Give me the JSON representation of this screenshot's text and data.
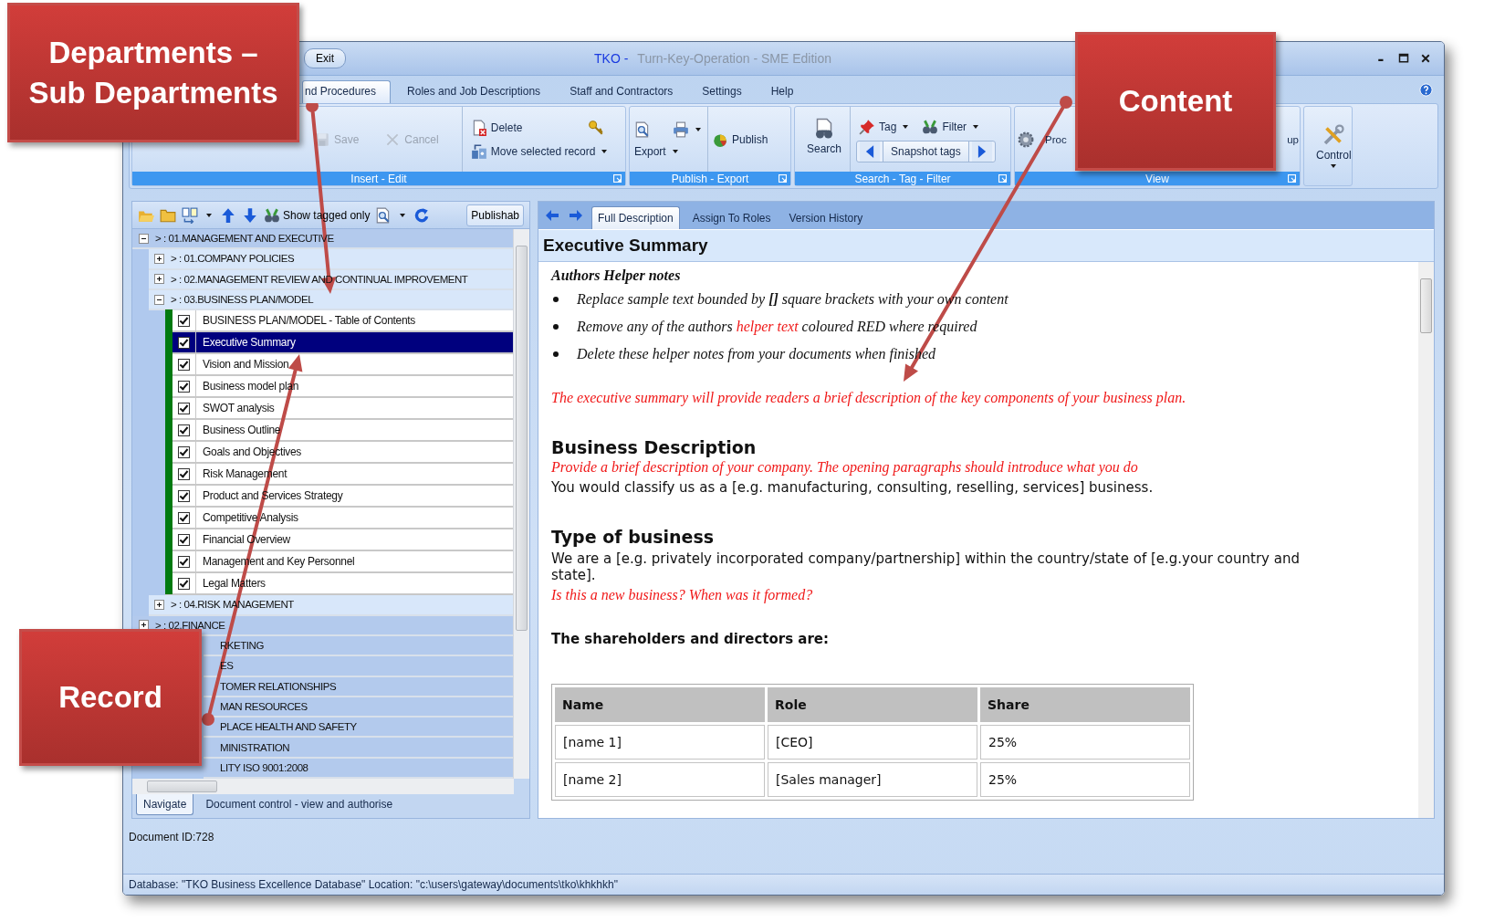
{
  "callouts": [
    {
      "kind": "departments",
      "lines": [
        "Departments –",
        "Sub Departments"
      ]
    },
    {
      "kind": "content",
      "lines": [
        "Content"
      ]
    },
    {
      "kind": "record",
      "lines": [
        "Record"
      ]
    }
  ],
  "window": {
    "exit_button": "Exit",
    "title_app": "TKO -",
    "title": "Turn-Key-Operation - SME Edition"
  },
  "menu_tabs": [
    {
      "label": "nd Procedures",
      "selected": true
    },
    {
      "label": "Roles and Job Descriptions",
      "selected": false
    },
    {
      "label": "Staff and Contractors",
      "selected": false
    },
    {
      "label": "Settings",
      "selected": false
    },
    {
      "label": "Help",
      "selected": false
    }
  ],
  "ribbon": [
    {
      "caption": "Insert - Edit",
      "columns": [
        [
          [
            {
              "kind": "small",
              "label": "Save",
              "disabled": true,
              "dropdown": false
            },
            {
              "kind": "small",
              "label": "Cancel",
              "disabled": true,
              "dropdown": false
            }
          ]
        ],
        [
          [
            {
              "kind": "small",
              "label": "Delete",
              "disabled": false,
              "dropdown": false
            },
            {
              "kind": "icon",
              "disabled": false,
              "dropdown": false
            }
          ],
          [
            {
              "kind": "small",
              "label": "Move selected record",
              "disabled": false,
              "dropdown": true
            }
          ]
        ]
      ]
    },
    {
      "caption": "Publish - Export",
      "columns": [
        [
          [
            {
              "kind": "icon",
              "disabled": false,
              "dropdown": false
            },
            {
              "kind": "icon",
              "disabled": false,
              "dropdown": true
            }
          ],
          [
            {
              "kind": "text",
              "label": "Export",
              "disabled": false,
              "dropdown": true
            }
          ]
        ],
        [
          [
            {
              "kind": "small",
              "label": "Publish",
              "disabled": false,
              "dropdown": false
            }
          ]
        ]
      ]
    },
    {
      "caption": "Search - Tag - Filter",
      "columns": [
        [
          [
            {
              "kind": "large",
              "label": "Search",
              "disabled": false,
              "dropdown": false
            }
          ]
        ],
        [
          [
            {
              "kind": "small",
              "label": "Tag",
              "disabled": false,
              "dropdown": true
            },
            {
              "kind": "small",
              "label": "Filter",
              "disabled": false,
              "dropdown": true
            }
          ],
          [
            {
              "kind": "nav",
              "label": "Snapshot tags",
              "disabled": false
            }
          ]
        ]
      ]
    },
    {
      "caption": "View",
      "columns": [
        [
          [
            {
              "kind": "small",
              "label": "Proc",
              "disabled": false
            }
          ]
        ],
        [
          [
            {
              "kind": "text",
              "label": "up",
              "disabled": false
            }
          ]
        ]
      ]
    },
    {
      "columns": [
        [
          [
            {
              "kind": "large",
              "label": "Control",
              "disabled": false,
              "dropdown": true
            }
          ]
        ]
      ]
    }
  ],
  "navigator": {
    "toolbar": {
      "filter_button": "Show tagged only",
      "publish_button": "Publishab"
    },
    "tree": [
      {
        "kind": "group",
        "label": "> : 01.MANAGEMENT AND EXECUTIVE",
        "expanded": true,
        "children": [
          {
            "kind": "group",
            "label": "> : 01.COMPANY POLICIES",
            "expanded": false
          },
          {
            "kind": "group",
            "label": "> : 02.MANAGEMENT REVIEW AND CONTINUAL IMPROVEMENT",
            "expanded": false
          },
          {
            "kind": "group",
            "label": "> : 03.BUSINESS PLAN/MODEL",
            "expanded": true,
            "children": [
              {
                "kind": "record",
                "label": "BUSINESS PLAN/MODEL - Table of Contents",
                "checked": true,
                "selected": false
              },
              {
                "kind": "record",
                "label": "Executive Summary",
                "checked": true,
                "selected": true
              },
              {
                "kind": "record",
                "label": "Vision and Mission",
                "checked": true,
                "selected": false
              },
              {
                "kind": "record",
                "label": "Business model plan",
                "checked": true,
                "selected": false
              },
              {
                "kind": "record",
                "label": "SWOT analysis",
                "checked": true,
                "selected": false
              },
              {
                "kind": "record",
                "label": "Business Outline",
                "checked": true,
                "selected": false
              },
              {
                "kind": "record",
                "label": "Goals and Objectives",
                "checked": true,
                "selected": false
              },
              {
                "kind": "record",
                "label": "Risk Management",
                "checked": true,
                "selected": false
              },
              {
                "kind": "record",
                "label": "Product and Services Strategy",
                "checked": true,
                "selected": false
              },
              {
                "kind": "record",
                "label": "Competitive Analysis",
                "checked": true,
                "selected": false
              },
              {
                "kind": "record",
                "label": "Financial Overview",
                "checked": true,
                "selected": false
              },
              {
                "kind": "record",
                "label": "Management and Key Personnel",
                "checked": true,
                "selected": false
              },
              {
                "kind": "record",
                "label": "Legal Matters",
                "checked": true,
                "selected": false
              }
            ]
          },
          {
            "kind": "group",
            "label": "> : 04.RISK MANAGEMENT",
            "expanded": false
          }
        ]
      },
      {
        "kind": "group",
        "label": "> : 02.FINANCE",
        "expanded": false
      },
      {
        "kind": "clipped",
        "label": "RKETING"
      },
      {
        "kind": "clipped",
        "label": "ES"
      },
      {
        "kind": "clipped",
        "label": "TOMER RELATIONSHIPS"
      },
      {
        "kind": "clipped",
        "label": "MAN RESOURCES"
      },
      {
        "kind": "clipped",
        "label": "PLACE HEALTH AND SAFETY"
      },
      {
        "kind": "clipped",
        "label": "MINISTRATION"
      },
      {
        "kind": "clipped",
        "label": "LITY ISO 9001:2008"
      }
    ],
    "bottom_tabs": [
      {
        "label": "Navigate",
        "selected": true
      },
      {
        "label": "Document control - view and authorise",
        "selected": false
      }
    ]
  },
  "content": {
    "tabs": [
      {
        "label": "Full Description",
        "selected": true
      },
      {
        "label": "Assign To Roles",
        "selected": false
      },
      {
        "label": "Version History",
        "selected": false
      }
    ],
    "title": "Executive Summary",
    "blocks": [
      {
        "kind": "note_title",
        "text": "Authors Helper notes"
      },
      {
        "kind": "bullet",
        "parts": [
          {
            "text": "Replace sample text bounded by **[]** square brackets with your own content",
            "helper": false
          }
        ]
      },
      {
        "kind": "bullet",
        "parts": [
          {
            "text": "Remove any of the authors ",
            "helper": false
          },
          {
            "text": "helper text",
            "helper": true
          },
          {
            "text": " coloured RED where required",
            "helper": false
          }
        ]
      },
      {
        "kind": "bullet",
        "parts": [
          {
            "text": "Delete these helper notes from your documents when finished",
            "helper": false
          }
        ]
      },
      {
        "kind": "helper",
        "text": "The executive summary will provide readers a brief  description of the key components of your business plan."
      },
      {
        "kind": "heading",
        "text": "Business Description"
      },
      {
        "kind": "helper",
        "text": "Provide a brief description of your company. The opening paragraphs should introduce what you do"
      },
      {
        "kind": "text",
        "text": "You would classify us as a [e.g. manufacturing, consulting, reselling, services] business."
      },
      {
        "kind": "heading",
        "text": "Type of business"
      },
      {
        "kind": "text",
        "text": "We are a [e.g. privately incorporated company/partnership] within the country/state of [e.g.your country and state]."
      },
      {
        "kind": "helper",
        "text": "Is this a new business? When was it formed?"
      },
      {
        "kind": "label",
        "text": "The shareholders and directors are:"
      },
      {
        "kind": "table",
        "columns": [
          "Name",
          "Role",
          "Share"
        ],
        "rows": [
          [
            "[name 1]",
            "[CEO]",
            "25%"
          ],
          [
            "[name 2]",
            "[Sales manager]",
            "25%"
          ]
        ]
      }
    ]
  },
  "document_id": "Document ID:728",
  "status_bar": "Database: \"TKO Business Excellence Database\" Location: \"c:\\users\\gateway\\documents\\tko\\khkhkh\""
}
